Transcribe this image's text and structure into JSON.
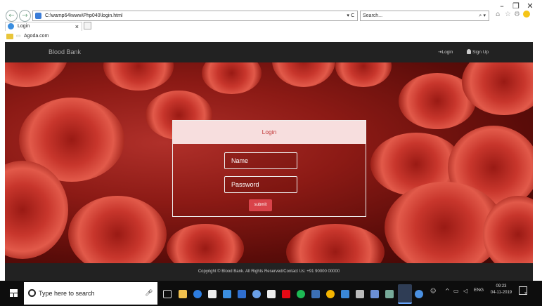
{
  "browser": {
    "window_controls": [
      "–",
      "❐",
      "✕"
    ],
    "address": "C:\\wamp64\\www\\Php040\\login.html",
    "address_controls": "▾ C",
    "search_placeholder": "Search...",
    "search_controls": "⌕ ▾",
    "tab_title": "Login",
    "tab_close": "×",
    "favorites": [
      "Agoda.com"
    ]
  },
  "site": {
    "brand": "Blood Bank",
    "nav": [
      {
        "icon": "login-icon",
        "label": "Login"
      },
      {
        "icon": "user-icon",
        "label": "Sign Up"
      }
    ],
    "panel": {
      "title": "Login",
      "name_placeholder": "Name",
      "password_placeholder": "Password",
      "submit_label": "submit"
    },
    "footer": "Copyright © Blood Bank. All Rights Reserved/Contact Us: +91 90000 00000"
  },
  "taskbar": {
    "search_placeholder": "Type here to search",
    "language": "ENG",
    "time": "09:23",
    "date": "04-11-2019",
    "notification_count": "2"
  },
  "colors": {
    "nav_bg": "#222222",
    "panel_header": "#f7dede",
    "accent_red": "#d9434a",
    "taskbar": "#0d0d0d"
  }
}
